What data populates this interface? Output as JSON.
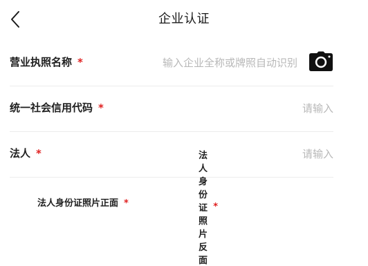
{
  "header": {
    "title": "企业认证",
    "back_icon": "chevron-left-icon"
  },
  "form": {
    "required_mark": "*",
    "fields": [
      {
        "label": "营业执照名称",
        "placeholder": "输入企业全称或牌照自动识别",
        "icon": "camera-icon"
      },
      {
        "label": "统一社会信用代码",
        "placeholder": "请输入"
      },
      {
        "label": "法人",
        "placeholder": "请输入"
      }
    ]
  },
  "id_photos": {
    "front_label": "法人身份证照片正面",
    "back_label": "法人身份证照片反面"
  },
  "colors": {
    "required": "#e02020",
    "placeholder": "#b8b8b8",
    "divider": "#ececec"
  }
}
